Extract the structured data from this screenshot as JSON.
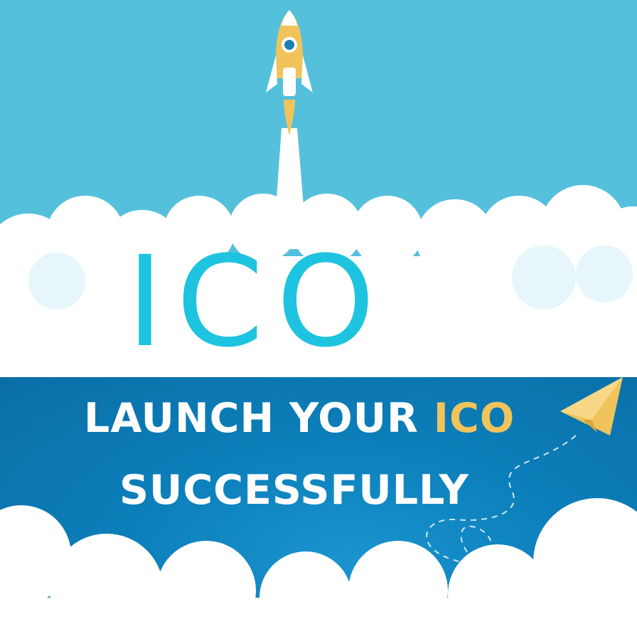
{
  "hero": {
    "title": "ICO"
  },
  "headline": {
    "line1_prefix": "LAUNCH YOUR ",
    "line1_highlight": "ICO",
    "line2": "SUCCESSFULLY"
  },
  "colors": {
    "sky": "#54c0dc",
    "band": "#0c7fba",
    "title": "#1ec3e0",
    "accent": "#f0c45b",
    "cloud": "#ffffff"
  },
  "icons": [
    "rocket-icon",
    "paper-plane-icon"
  ]
}
